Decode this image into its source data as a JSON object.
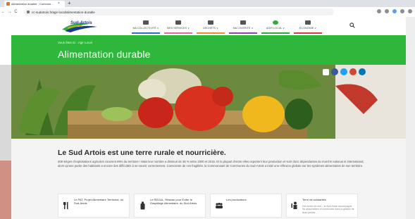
{
  "browser": {
    "tab_title": "Alimentation durable - Commun...",
    "tab_close": "×",
    "new_tab": "+",
    "nav_back": "←",
    "nav_forward": "→",
    "nav_reload": "C",
    "url": "cc-sudartois.fr/agir-local/alimentation-durable"
  },
  "header": {
    "logo_text": "Sud-Artois",
    "nav": [
      {
        "label": "MA COLLECTIVITÉ ∨",
        "color": "#2b6cc4",
        "icon": "building-icon"
      },
      {
        "label": "MES SERVICES ∨",
        "color": "#e06a9a",
        "icon": "bus-icon"
      },
      {
        "label": "DÉCHETS ∨",
        "color": "#f08a24",
        "icon": "trash-icon"
      },
      {
        "label": "MA CIVIERITÉ ∨",
        "color": "#8e44ad",
        "icon": "hands-icon"
      },
      {
        "label": "AGIR LOCAL ∨",
        "color": "#2eaa3a",
        "icon": "leaf-icon"
      },
      {
        "label": "ÉCONOMIE ∨",
        "color": "#d93b3b",
        "icon": "chart-icon"
      }
    ]
  },
  "hero": {
    "breadcrumb": "Vous êtes ici : Agir Local",
    "title": "Alimentation durable",
    "social": [
      {
        "name": "facebook",
        "color": "#3b5998"
      },
      {
        "name": "twitter",
        "color": "#1da1f2"
      },
      {
        "name": "email",
        "color": "#d14836"
      },
      {
        "name": "linkedin",
        "color": "#0077b5"
      }
    ]
  },
  "content": {
    "heading": "Le Sud Artois est une terre rurale et nourricière.",
    "body": "408 sièges d'exploitations agricoles couvrent 89% du territoire ! Mais leur nombre a diminué de 36 % entre 2000 et 2016. Et la plupart d'entre elles exportent leur production et sont donc dépendantes du marché national et international, alors qu'une partie des habitants a encore des difficultés à se nourrir correctement. Consciente de ces fragilités, la Communauté de Communes du Sud-Artois a initié une réflexion globale sur les systèmes alimentaires de son territoire.",
    "cards": [
      {
        "title": "Le PAT, Projet Alimentaire Territorial, du Sud-Artois",
        "sub": "",
        "icon": "utensils-icon"
      },
      {
        "title": "Le REGAL, Réseau pour Éviter le Gaspillage Alimentaire, du Sud-Artois",
        "sub": "",
        "icon": "bottle-icon"
      },
      {
        "title": "Les producteurs",
        "sub": "",
        "icon": "people-icon"
      },
      {
        "title": "Terre de solidarités",
        "sub": "Des terres en vert – le Sud-Artois accompagne les associations et communes dans la gestion de leurs jardins",
        "icon": "gardener-icon"
      }
    ]
  }
}
